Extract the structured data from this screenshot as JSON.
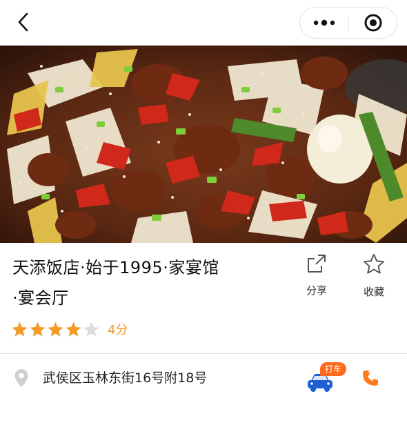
{
  "nav": {
    "back_icon": "chevron-left-icon",
    "more_icon": "more-dots-icon",
    "close_icon": "target-circle-icon"
  },
  "hero": {
    "icon": "food-photo"
  },
  "restaurant": {
    "title_line1": "天添饭店·始于1995·家宴馆",
    "title_line2": "·宴会厅",
    "rating_stars": 4,
    "rating_max": 5,
    "rating_text": "4分"
  },
  "actions": {
    "share_label": "分享",
    "favorite_label": "收藏"
  },
  "location": {
    "address": "武侯区玉林东街16号附18号",
    "taxi_label": "打车"
  },
  "colors": {
    "accent": "#f39a2b",
    "star_empty": "#dcdcdc",
    "taxi_orange": "#ff6a1a",
    "taxi_blue": "#1f5fd6",
    "phone_orange": "#ff7a1a"
  }
}
